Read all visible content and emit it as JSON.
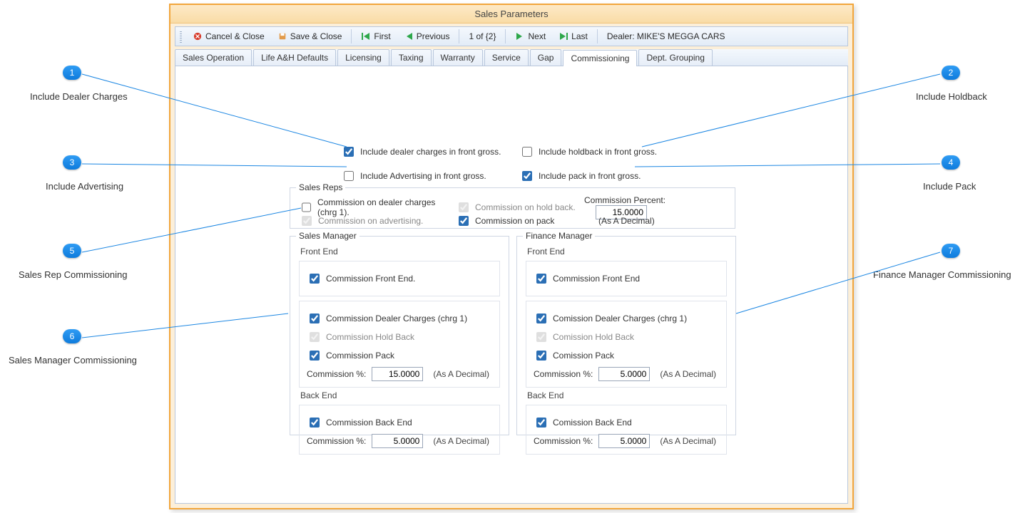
{
  "window": {
    "title": "Sales Parameters"
  },
  "toolbar": {
    "cancel_close": "Cancel & Close",
    "save_close": "Save & Close",
    "first": "First",
    "previous": "Previous",
    "page_counter": "1 of {2}",
    "next": "Next",
    "last": "Last",
    "dealer": "Dealer: MIKE'S MEGGA CARS"
  },
  "tabs": [
    {
      "label": "Sales Operation"
    },
    {
      "label": "Life A&H Defaults"
    },
    {
      "label": "Licensing"
    },
    {
      "label": "Taxing"
    },
    {
      "label": "Warranty"
    },
    {
      "label": "Service"
    },
    {
      "label": "Gap"
    },
    {
      "label": "Commissioning",
      "active": true
    },
    {
      "label": "Dept. Grouping"
    }
  ],
  "gross": {
    "dealer_charges": "Include dealer charges in front gross.",
    "holdback": "Include holdback in front gross.",
    "advertising": "Include Advertising in front gross.",
    "pack": "Include pack in front gross."
  },
  "sales_reps": {
    "title": "Sales Reps",
    "dealer_charges": "Commission on dealer charges (chrg 1).",
    "holdback": "Commission on hold back.",
    "advertising": "Commission on advertising.",
    "pack": "Commission on pack",
    "commission_percent_label": "Commission Percent:",
    "commission_percent_value": "15.0000",
    "as_decimal": "(As A Decimal)"
  },
  "sales_manager": {
    "title": "Sales Manager",
    "front_end": "Front End",
    "front_end_chk": "Commission Front End.",
    "dealer_charges": "Commission Dealer Charges (chrg 1)",
    "holdback": "Commission Hold Back",
    "pack": "Commission Pack",
    "pct_label": "Commission %:",
    "front_pct": "15.0000",
    "as_decimal": "(As A Decimal)",
    "back_end": "Back End",
    "back_end_chk": "Commission Back End",
    "back_pct": "5.0000"
  },
  "finance_manager": {
    "title": "Finance Manager",
    "front_end": "Front End",
    "front_end_chk": "Commission Front End",
    "dealer_charges": "Comission Dealer Charges (chrg 1)",
    "holdback": "Comission Hold Back",
    "pack": "Comission Pack",
    "pct_label": "Commission %:",
    "front_pct": "5.0000",
    "as_decimal": "(As A Decimal)",
    "back_end": "Back End",
    "back_end_chk": "Comission Back End",
    "back_pct": "5.0000"
  },
  "callouts": {
    "c1": "Include Dealer Charges",
    "c2": "Include Holdback",
    "c3": "Include Advertising",
    "c4": "Include Pack",
    "c5": "Sales Rep Commissioning",
    "c6": "Sales Manager Commissioning",
    "c7": "Finance Manager Commissioning"
  }
}
